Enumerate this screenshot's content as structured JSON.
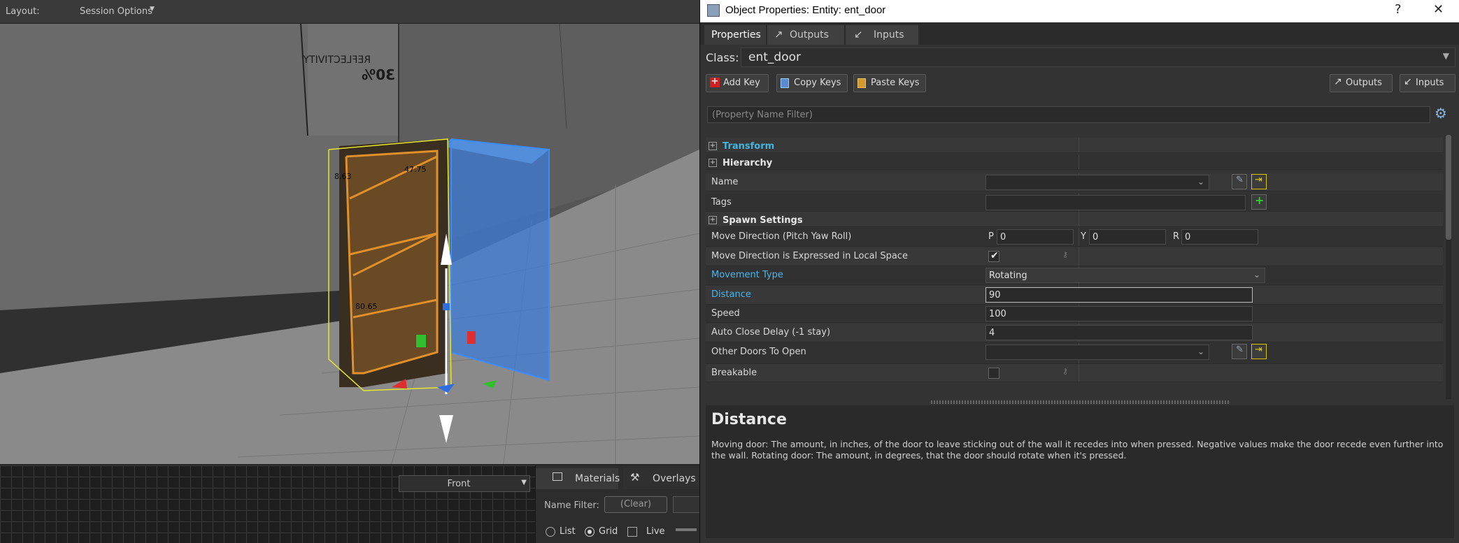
{
  "editor": {
    "layout_label": "Layout:",
    "session_options": "Session Options",
    "view_select": "Front",
    "wall_text1": "REFLECTIVITY",
    "wall_text2": "30%",
    "dim_label_top": "47.75",
    "dim_label_left": "8.63",
    "dim_label_mid": "80.65"
  },
  "materials_panel": {
    "tab_materials": "Materials",
    "tab_overlays": "Overlays",
    "name_filter_label": "Name Filter:",
    "clear_button": "(Clear)",
    "radio_list": "List",
    "radio_grid": "Grid",
    "check_live": "Live"
  },
  "window": {
    "title": "Object Properties: Entity: ent_door",
    "help_button": "?",
    "close_button": "✕"
  },
  "tabs": [
    "Properties",
    "Outputs",
    "Inputs"
  ],
  "class": {
    "label": "Class:",
    "value": "ent_door"
  },
  "toolbar": {
    "add_key": "Add Key",
    "copy_keys": "Copy Keys",
    "paste_keys": "Paste Keys",
    "outputs": "Outputs",
    "inputs": "Inputs"
  },
  "filter_placeholder": "(Property Name Filter)",
  "properties": [
    {
      "name": "Transform",
      "kind": "section",
      "teal": true
    },
    {
      "name": "Hierarchy",
      "kind": "section",
      "teal": false
    },
    {
      "name": "Name",
      "kind": "dropdown",
      "value": ""
    },
    {
      "name": "Tags",
      "kind": "tags",
      "value": ""
    },
    {
      "name": "Spawn Settings",
      "kind": "section",
      "teal": false
    },
    {
      "name": "Move Direction (Pitch Yaw Roll)",
      "kind": "pyr",
      "p": "0",
      "y": "0",
      "r": "0"
    },
    {
      "name": "Move Direction is Expressed in Local Space",
      "kind": "check",
      "checked": true
    },
    {
      "name": "Movement Type",
      "kind": "combo",
      "value": "Rotating",
      "blue": true
    },
    {
      "name": "Distance",
      "kind": "text",
      "value": "90",
      "blue": true,
      "focus": true
    },
    {
      "name": "Speed",
      "kind": "text",
      "value": "100"
    },
    {
      "name": "Auto Close Delay (-1 stay)",
      "kind": "text",
      "value": "4"
    },
    {
      "name": "Other Doors To Open",
      "kind": "dropdown",
      "value": ""
    },
    {
      "name": "Breakable",
      "kind": "check",
      "checked": false
    }
  ],
  "pyr_labels": {
    "p": "P",
    "y": "Y",
    "r": "R"
  },
  "help": {
    "title": "Distance",
    "text": "Moving door: The amount, in inches, of the door to leave sticking out of the wall it recedes into when pressed. Negative values make the door recede even further into the wall. Rotating door: The amount, in degrees, that the door should rotate when it's pressed."
  }
}
